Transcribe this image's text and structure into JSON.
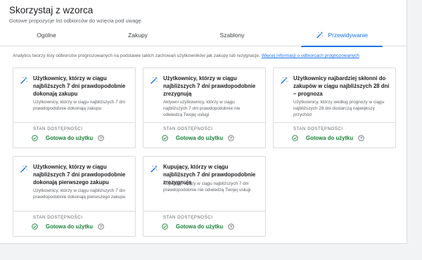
{
  "header": {
    "title": "Skorzystaj z wzorca",
    "subtitle": "Gotowe propozycje list odbiorców do wzięcia pod uwagę."
  },
  "tabs": [
    {
      "label": "Ogólne",
      "active": false
    },
    {
      "label": "Zakupy",
      "active": false
    },
    {
      "label": "Szablony",
      "active": false
    },
    {
      "label": "Przewidywanie",
      "active": true,
      "icon": "magic-wand-icon"
    }
  ],
  "info": {
    "text": "Analytics tworzy listy odbiorców prognozowanych na podstawie takich zachowań użytkowników jak zakupy lub rezygnacje.",
    "link": "Więcej informacji o odbiorcach prognozowanych"
  },
  "cards": [
    {
      "title": "Użytkownicy, którzy w ciągu najbliższych 7 dni prawdopodobnie dokonają zakupu",
      "description": "Użytkownicy, którzy w ciągu najbliższych 7 dni prawdopodobnie dokonają zakupu",
      "status_label": "STAN DOSTĘPNOŚCI",
      "status": "Gotowa do użytku",
      "icon": "magic-wand-icon"
    },
    {
      "title": "Użytkownicy, którzy w ciągu najbliższych 7 dni prawdopodobnie zrezygnują",
      "description": "Aktywni użytkownicy, którzy w ciągu najbliższych 7 dni prawdopodobnie nie odwiedzą Twojej usługi",
      "status_label": "STAN DOSTĘPNOŚCI",
      "status": "Gotowa do użytku",
      "icon": "magic-wand-icon"
    },
    {
      "title": "Użytkownicy najbardziej skłonni do zakupów w ciągu najbliższych 28 dni – prognoza",
      "description": "Użytkownicy, którzy według prognozy w ciągu najbliższych 28 dni dostarczą największy przychód",
      "status_label": "STAN DOSTĘPNOŚCI",
      "status": "Gotowa do użytku",
      "icon": "magic-wand-icon"
    },
    {
      "title": "Użytkownicy, którzy w ciągu najbliższych 7 dni prawdopodobnie dokonają pierwszego zakupu",
      "description": "Użytkownicy, którzy w ciągu najbliższych 7 dni prawdopodobnie dokonają pierwszego zakupu",
      "status_label": "STAN DOSTĘPNOŚCI",
      "status": "Gotowa do użytku",
      "icon": "magic-wand-icon"
    },
    {
      "title": "Kupujący, którzy w ciągu najbliższych 7 dni prawdopodobnie zrezygnują",
      "description": "Kupujący, którzy w ciągu najbliższych 7 dni prawdopodobnie nie odwiedzą Twojej usługi",
      "status_label": "STAN DOSTĘPNOŚCI",
      "status": "Gotowa do użytku",
      "icon": "magic-wand-icon"
    }
  ],
  "colors": {
    "accent": "#1a73e8",
    "success": "#188038",
    "text": "#202124",
    "muted": "#5f6368",
    "border": "#dadce0"
  }
}
